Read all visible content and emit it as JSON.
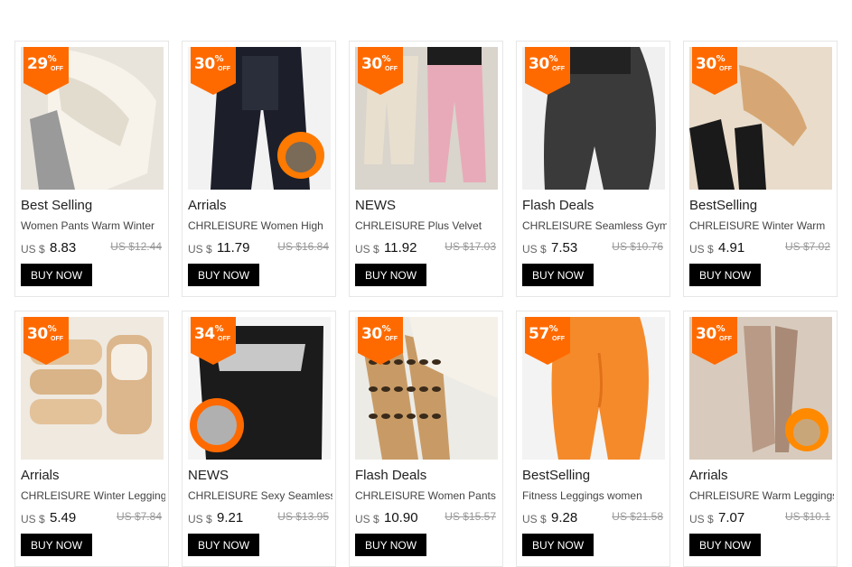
{
  "products": [
    {
      "badge_pct": "29",
      "badge_off": "OFF",
      "title": "Best Selling",
      "subtitle": "Women Pants Warm Winter",
      "currency": "US $",
      "price": "8.83",
      "old_price": "US $12.44",
      "button": "BUY NOW",
      "image": {
        "bg": "#e8e4dc",
        "fg": "#f1ede4",
        "accent": "#9a9a9a",
        "icon": "fleece-leggings"
      }
    },
    {
      "badge_pct": "30",
      "badge_off": "OFF",
      "title": "Arrials",
      "subtitle": "CHRLEISURE Women High",
      "currency": "US $",
      "price": "11.79",
      "old_price": "US $16.84",
      "button": "BUY NOW",
      "image": {
        "bg": "#f2f2f2",
        "fg": "#1c1f2a",
        "accent": "#ff7a00",
        "icon": "waist-trainer-leggings"
      }
    },
    {
      "badge_pct": "30",
      "badge_off": "OFF",
      "title": "NEWS",
      "subtitle": "CHRLEISURE Plus Velvet",
      "currency": "US $",
      "price": "11.92",
      "old_price": "US $17.03",
      "button": "BUY NOW",
      "image": {
        "bg": "#d9d4cc",
        "fg": "#e9dfcf",
        "accent": "#e8aab8",
        "icon": "jogger-pants"
      }
    },
    {
      "badge_pct": "30",
      "badge_off": "OFF",
      "title": "Flash Deals",
      "subtitle": "CHRLEISURE Seamless Gym",
      "currency": "US $",
      "price": "7.53",
      "old_price": "US $10.76",
      "button": "BUY NOW",
      "image": {
        "bg": "#f0f0f0",
        "fg": "#3a3a3a",
        "accent": "#222222",
        "icon": "gym-leggings"
      }
    },
    {
      "badge_pct": "30",
      "badge_off": "OFF",
      "title": "BestSelling",
      "subtitle": "CHRLEISURE Winter Warm",
      "currency": "US $",
      "price": "4.91",
      "old_price": "US $7.02",
      "button": "BUY NOW",
      "image": {
        "bg": "#e9dccb",
        "fg": "#d6a774",
        "accent": "#1a1a1a",
        "icon": "fleece-tights"
      }
    },
    {
      "badge_pct": "30",
      "badge_off": "OFF",
      "title": "Arrials",
      "subtitle": "CHRLEISURE Winter Leggings",
      "currency": "US $",
      "price": "5.49",
      "old_price": "US $7.84",
      "button": "BUY NOW",
      "image": {
        "bg": "#efe9e0",
        "fg": "#e3c29a",
        "accent": "#f6efe5",
        "icon": "folded-leggings"
      }
    },
    {
      "badge_pct": "34",
      "badge_off": "OFF",
      "title": "NEWS",
      "subtitle": "CHRLEISURE Sexy Seamless",
      "currency": "US $",
      "price": "9.21",
      "old_price": "US $13.95",
      "button": "BUY NOW",
      "image": {
        "bg": "#f4f4f4",
        "fg": "#1b1b1b",
        "accent": "#c8c8c8",
        "icon": "sauna-leggings"
      }
    },
    {
      "badge_pct": "30",
      "badge_off": "OFF",
      "title": "Flash Deals",
      "subtitle": "CHRLEISURE Women Pants",
      "currency": "US $",
      "price": "10.90",
      "old_price": "US $15.57",
      "button": "BUY NOW",
      "image": {
        "bg": "#ecebe6",
        "fg": "#c89b66",
        "accent": "#f5f1e8",
        "icon": "leopard-leggings"
      }
    },
    {
      "badge_pct": "57",
      "badge_off": "OFF",
      "title": "BestSelling",
      "subtitle": "Fitness Leggings women",
      "currency": "US $",
      "price": "9.28",
      "old_price": "US $21.58",
      "button": "BUY NOW",
      "image": {
        "bg": "#f3f3f3",
        "fg": "#f58a2b",
        "accent": "#e07019",
        "icon": "orange-leggings"
      }
    },
    {
      "badge_pct": "30",
      "badge_off": "OFF",
      "title": "Arrials",
      "subtitle": "CHRLEISURE Warm Leggings",
      "currency": "US $",
      "price": "7.07",
      "old_price": "US $10.1",
      "button": "BUY NOW",
      "image": {
        "bg": "#d8cbbd",
        "fg": "#b89a86",
        "accent": "#ff8a00",
        "icon": "sheer-tights"
      }
    }
  ],
  "colors": {
    "badge": "#ff6a00",
    "button_bg": "#000000",
    "button_text": "#ffffff",
    "strike": "#999999"
  }
}
